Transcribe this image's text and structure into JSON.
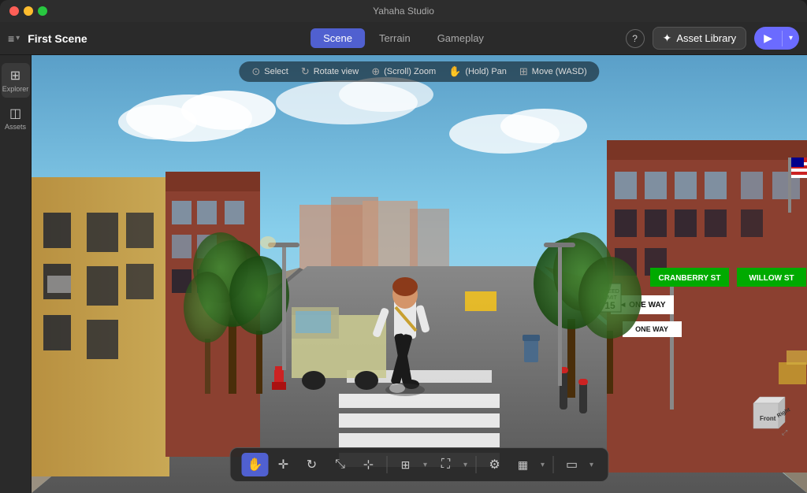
{
  "window": {
    "title": "Yahaha Studio"
  },
  "title_bar": {
    "title": "Yahaha Studio",
    "traffic_lights": [
      "red",
      "yellow",
      "green"
    ]
  },
  "toolbar": {
    "menu_icon": "≡",
    "scene_title": "First Scene",
    "tabs": [
      {
        "id": "scene",
        "label": "Scene",
        "active": true
      },
      {
        "id": "terrain",
        "label": "Terrain",
        "active": false
      },
      {
        "id": "gameplay",
        "label": "Gameplay",
        "active": false
      }
    ],
    "help_label": "?",
    "asset_library_label": "Asset Library",
    "asset_library_icon": "✦",
    "play_icon": "▶",
    "dropdown_icon": "▾"
  },
  "sidebar": {
    "items": [
      {
        "id": "explorer",
        "icon": "⊞",
        "label": "Explorer",
        "active": true
      },
      {
        "id": "assets",
        "icon": "◫",
        "label": "Assets",
        "active": false
      }
    ]
  },
  "viewport": {
    "hints": [
      {
        "icon": "⊙",
        "label": "Select"
      },
      {
        "icon": "↻",
        "label": "Rotate view"
      },
      {
        "icon": "⊕",
        "label": "(Scroll) Zoom"
      },
      {
        "icon": "✋",
        "label": "(Hold) Pan"
      },
      {
        "icon": "⊞",
        "label": "Move (WASD)"
      }
    ]
  },
  "nav_cube": {
    "front_label": "Front",
    "right_label": "Right"
  },
  "bottom_toolbar": {
    "tools": [
      {
        "id": "hand",
        "icon": "✋",
        "active": true
      },
      {
        "id": "move",
        "icon": "✛",
        "active": false
      },
      {
        "id": "rotate",
        "icon": "↻",
        "active": false
      },
      {
        "id": "scale",
        "icon": "⤡",
        "active": false
      },
      {
        "id": "transform",
        "icon": "⊹",
        "active": false
      }
    ],
    "tools2": [
      {
        "id": "multiselect",
        "icon": "⊞",
        "active": false
      },
      {
        "id": "fullscreen",
        "icon": "⛶",
        "active": false
      }
    ],
    "tools3": [
      {
        "id": "settings",
        "icon": "⚙",
        "active": false
      },
      {
        "id": "grid",
        "icon": "⊞",
        "active": false
      }
    ],
    "tools4": [
      {
        "id": "camera",
        "icon": "▭",
        "active": false
      }
    ]
  }
}
